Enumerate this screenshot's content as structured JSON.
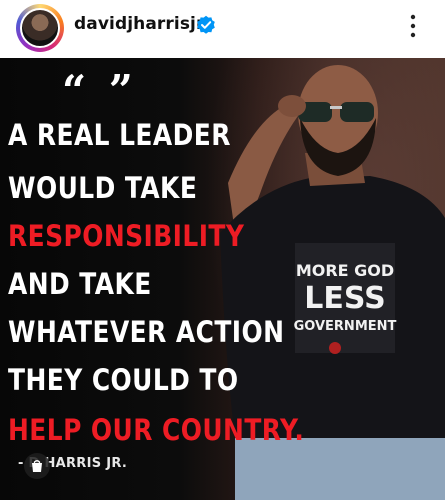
{
  "header": {
    "username": "davidjharrisjr",
    "verified_icon": "verified-badge-icon",
    "more_icon": "more-vertical-icon",
    "accent_color": "#0095f6"
  },
  "post": {
    "quote_marks": "“ ”",
    "lines": [
      {
        "text": "A REAL LEADER",
        "color": "white"
      },
      {
        "text": "WOULD TAKE",
        "color": "white"
      },
      {
        "text": "RESPONSIBILITY",
        "color": "red"
      },
      {
        "text": "AND TAKE",
        "color": "white"
      },
      {
        "text": "WHATEVER ACTION",
        "color": "white"
      },
      {
        "text": "THEY COULD TO",
        "color": "white"
      },
      {
        "text": "HELP OUR COUNTRY.",
        "color": "red"
      }
    ],
    "attribution": "- D HARRIS JR.",
    "shirt_text": [
      "MORE GOD",
      "LESS",
      "GOVERNMENT"
    ],
    "shop_icon": "shopping-bag-icon",
    "highlight_color": "#ee1c24"
  }
}
